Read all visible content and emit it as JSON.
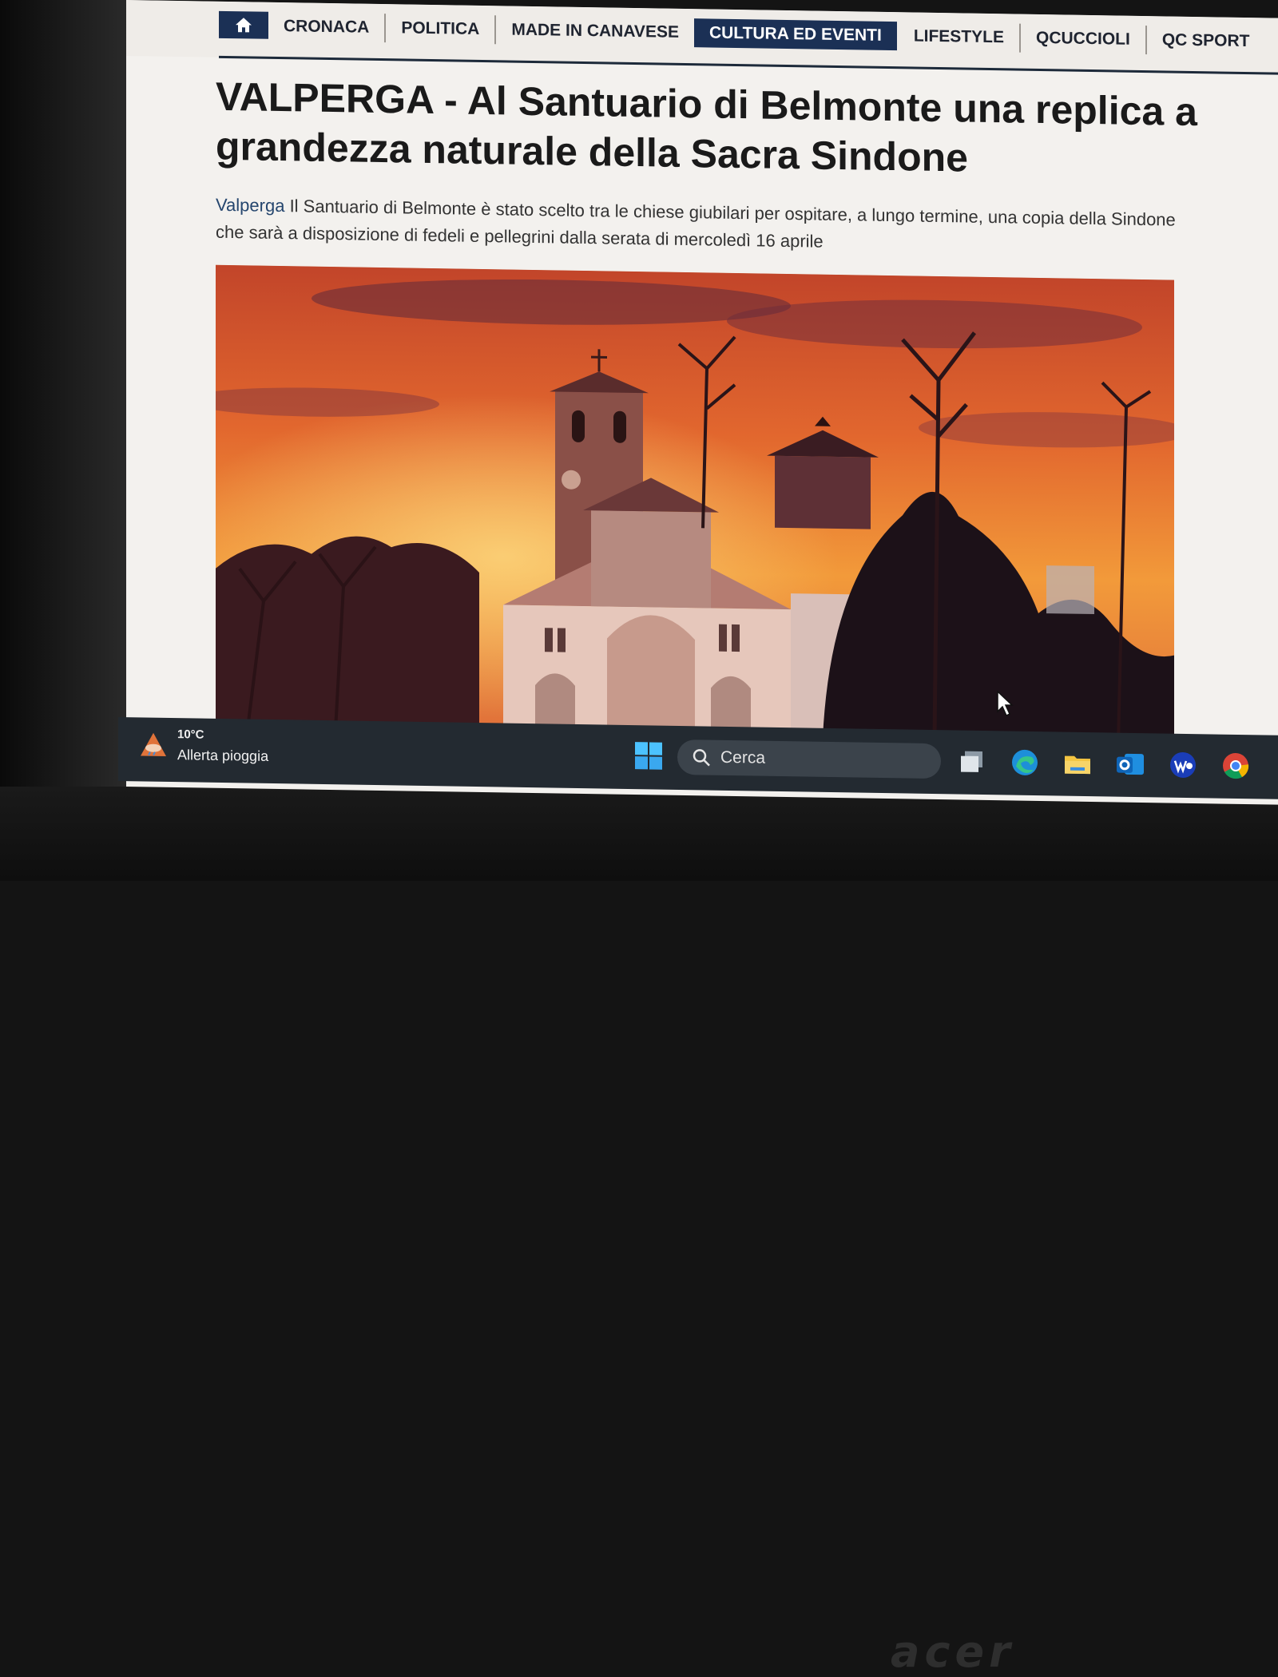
{
  "nav": {
    "home_icon": "home-icon",
    "items": [
      {
        "label": "CRONACA",
        "active": false
      },
      {
        "label": "POLITICA",
        "active": false
      },
      {
        "label": "MADE IN CANAVESE",
        "active": false
      },
      {
        "label": "CULTURA ED EVENTI",
        "active": true
      },
      {
        "label": "LIFESTYLE",
        "active": false
      },
      {
        "label": "QCUCCIOLI",
        "active": false
      },
      {
        "label": "QC SPORT",
        "active": false
      }
    ],
    "accent_color": "#1b3055"
  },
  "article": {
    "title": "VALPERGA - Al Santuario di Belmonte una replica a grandezza naturale della Sacra Sindone",
    "location": "Valperga",
    "lead": "Il Santuario di Belmonte è stato scelto tra le chiese giubilari per ospitare, a lungo termine, una copia della Sindone che sarà a disposizione di fedeli e pellegrini dalla serata di mercoledì 16 aprile",
    "image_subject": "Santuario di Belmonte at sunset"
  },
  "taskbar": {
    "weather": {
      "temp": "10°C",
      "text": "Allerta pioggia",
      "icon": "rain-alert-icon"
    },
    "search_placeholder": "Cerca",
    "apps": [
      "task-view-icon",
      "edge-icon",
      "file-explorer-icon",
      "outlook-icon",
      "app-icon",
      "chrome-icon"
    ]
  },
  "hardware": {
    "brand": "acer"
  }
}
